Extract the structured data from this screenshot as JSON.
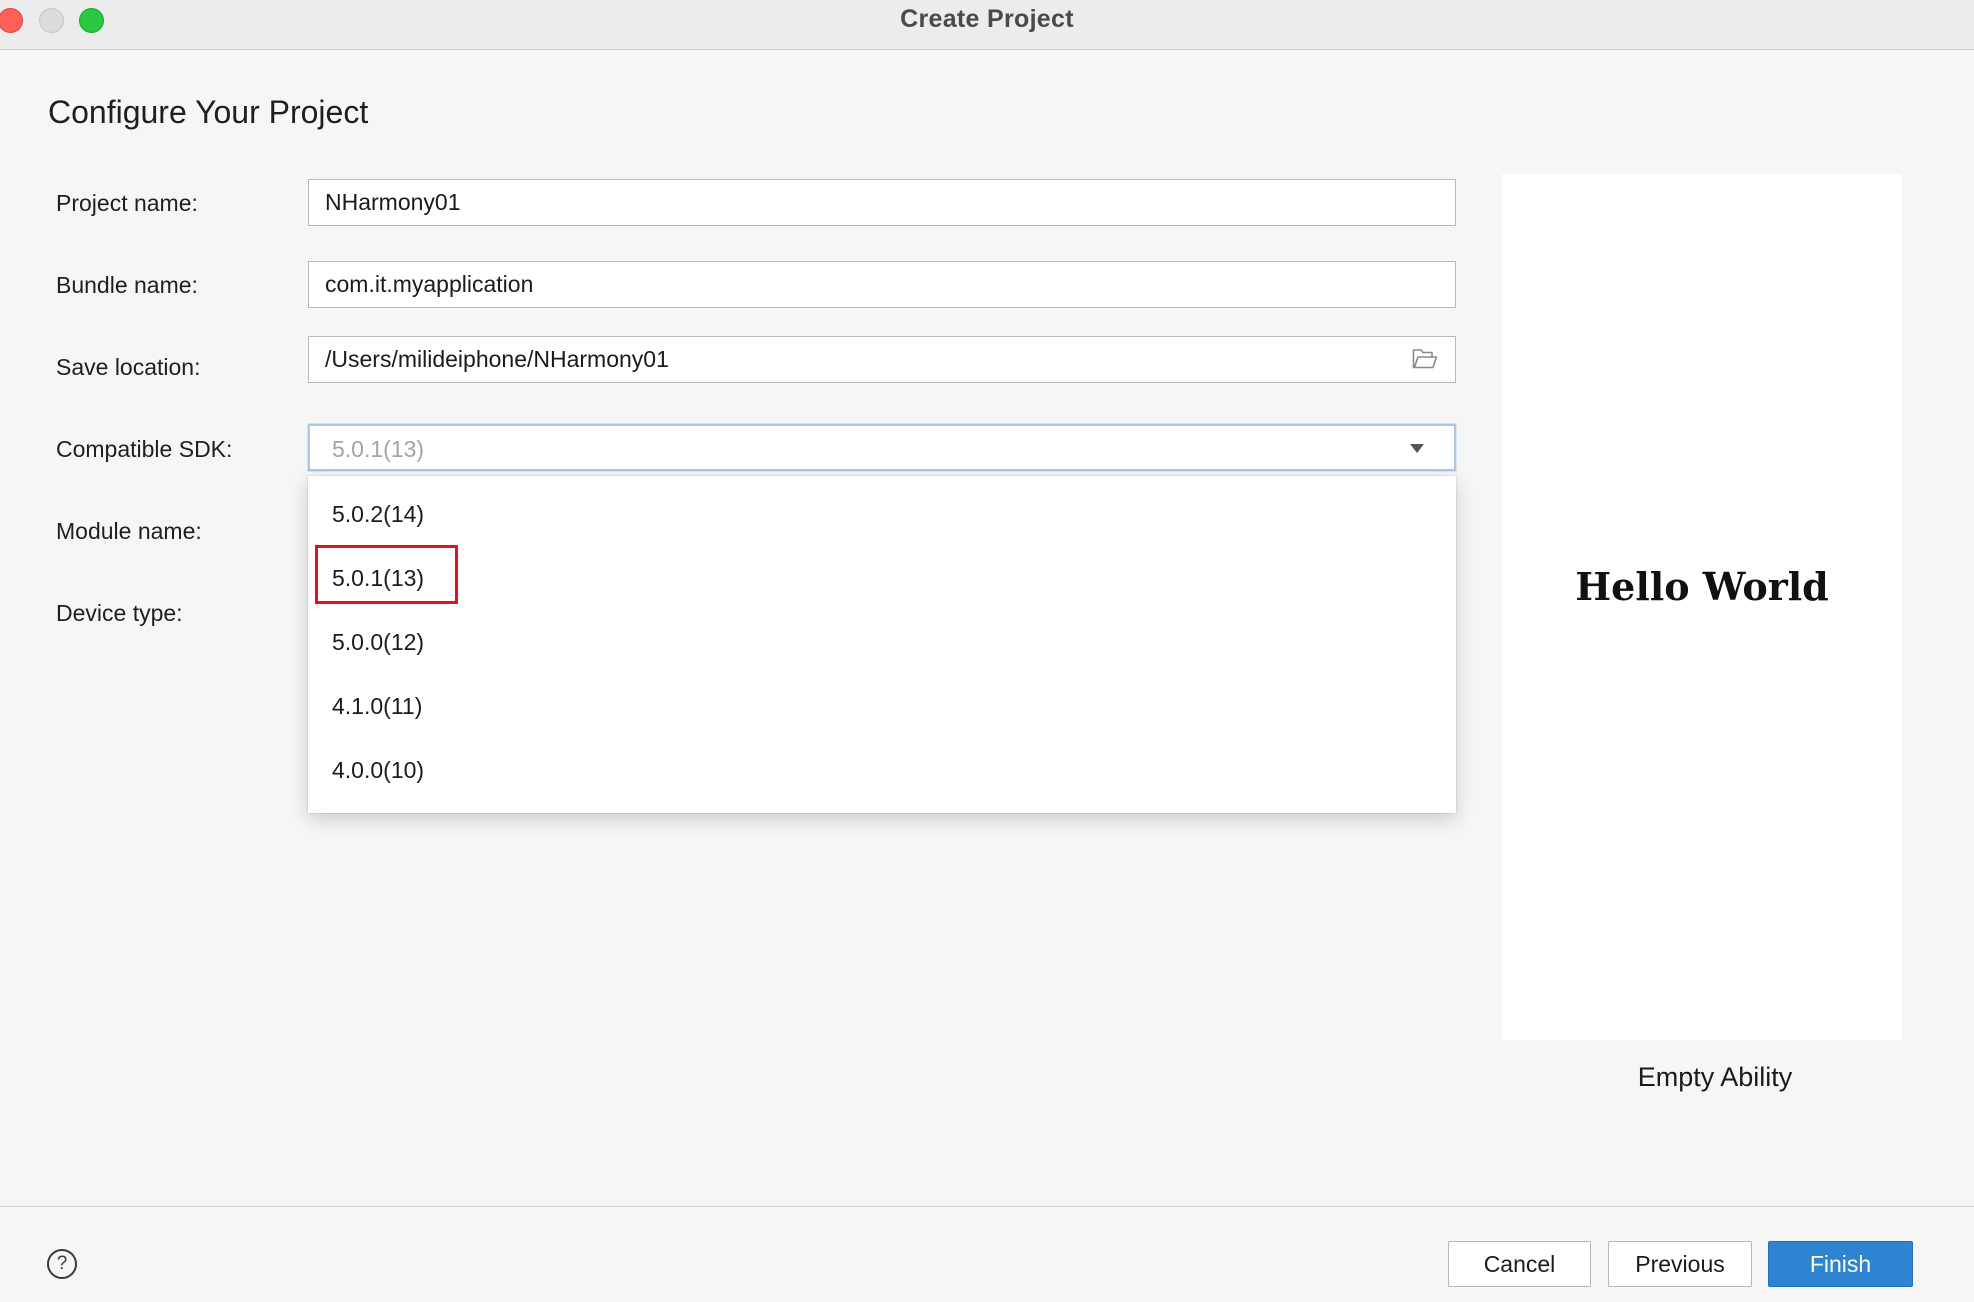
{
  "window": {
    "title": "Create Project"
  },
  "page": {
    "heading": "Configure Your Project"
  },
  "form": {
    "project_name": {
      "label": "Project name:",
      "value": "NHarmony01"
    },
    "bundle_name": {
      "label": "Bundle name:",
      "value": "com.it.myapplication"
    },
    "save_location": {
      "label": "Save location:",
      "value": "/Users/milideiphone/NHarmony01"
    },
    "compatible_sdk": {
      "label": "Compatible SDK:",
      "value": "5.0.1(13)",
      "options": [
        "5.0.2(14)",
        "5.0.1(13)",
        "5.0.0(12)",
        "4.1.0(11)",
        "4.0.0(10)"
      ],
      "highlighted_option": "5.0.1(13)"
    },
    "module_name": {
      "label": "Module name:"
    },
    "device_type": {
      "label": "Device type:"
    }
  },
  "preview": {
    "text": "Hello World",
    "template_name": "Empty Ability"
  },
  "footer": {
    "help_symbol": "?",
    "cancel_label": "Cancel",
    "previous_label": "Previous",
    "finish_label": "Finish"
  },
  "colors": {
    "accent": "#2f84d2",
    "highlight": "#e0141c",
    "close": "#fe5f57",
    "maximize": "#29c840"
  },
  "icons": {
    "save_location": "folder-open-icon",
    "select_caret": "caret-down-icon",
    "help": "help-circle-icon"
  }
}
